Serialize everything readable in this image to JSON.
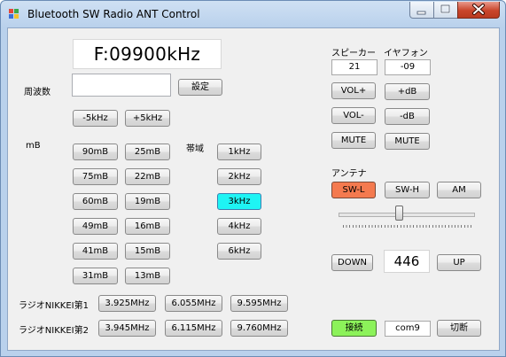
{
  "window": {
    "title": "Bluetooth SW Radio ANT Control"
  },
  "display": {
    "frequency": "F:09900kHz"
  },
  "frequency": {
    "label": "周波数",
    "input_value": "",
    "set_label": "設定"
  },
  "step": {
    "minus": "-5kHz",
    "plus": "+5kHz"
  },
  "meter_band": {
    "label": "mB",
    "col1": [
      "90mB",
      "75mB",
      "60mB",
      "49mB",
      "41mB",
      "31mB"
    ],
    "col2": [
      "25mB",
      "22mB",
      "19mB",
      "16mB",
      "15mB",
      "13mB"
    ]
  },
  "bandwidth": {
    "label": "帯域",
    "options": [
      "1kHz",
      "2kHz",
      "3kHz",
      "4kHz",
      "6kHz"
    ],
    "selected": "3kHz",
    "selected_color": "#1ef4f4"
  },
  "stations": [
    {
      "label": "ラジオNIKKEI第1",
      "freqs": [
        "3.925MHz",
        "6.055MHz",
        "9.595MHz"
      ]
    },
    {
      "label": "ラジオNIKKEI第2",
      "freqs": [
        "3.945MHz",
        "6.115MHz",
        "9.760MHz"
      ]
    }
  ],
  "speaker": {
    "label": "スピーカー",
    "volume": "21",
    "vol_up": "VOL+",
    "vol_down": "VOL-",
    "mute": "MUTE"
  },
  "earphone": {
    "label": "イヤフォン",
    "gain": "-09",
    "db_up": "+dB",
    "db_down": "-dB",
    "mute": "MUTE"
  },
  "antenna": {
    "label": "アンテナ",
    "options": [
      "SW-L",
      "SW-H",
      "AM"
    ],
    "selected": "SW-L",
    "selected_color": "#f47a4f",
    "slider_fraction": 0.45
  },
  "stepper": {
    "down": "DOWN",
    "value": "446",
    "up": "UP"
  },
  "connection": {
    "connect": "接続",
    "connect_color": "#8cf25a",
    "port": "com9",
    "disconnect": "切断"
  }
}
